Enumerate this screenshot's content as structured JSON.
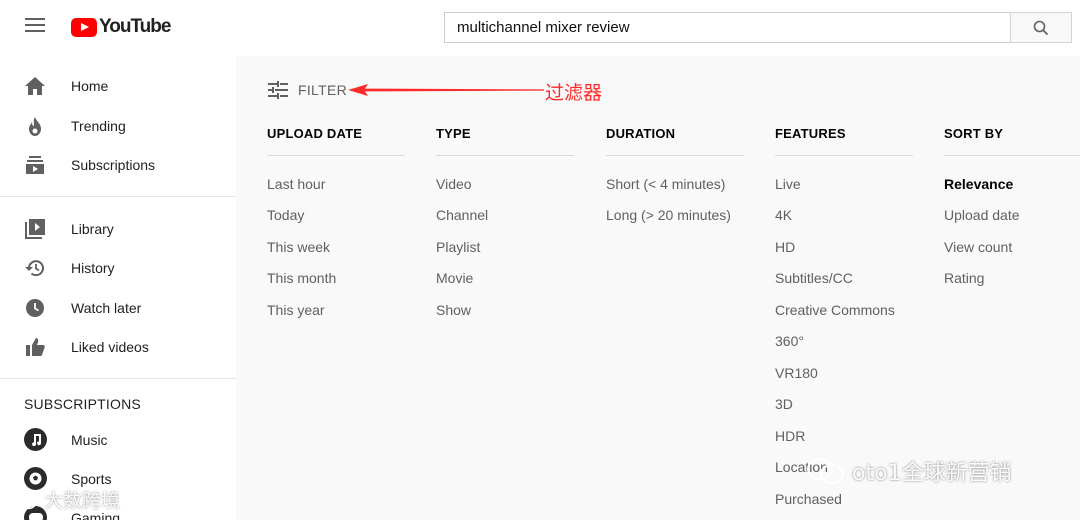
{
  "header": {
    "logo_text": "YouTube",
    "search_value": "multichannel mixer review",
    "icons": [
      "menu-icon",
      "search-icon"
    ],
    "brand_color": "#ff0000"
  },
  "sidebar": {
    "main_items": [
      {
        "label": "Home",
        "icon": "home-icon"
      },
      {
        "label": "Trending",
        "icon": "flame-icon"
      },
      {
        "label": "Subscriptions",
        "icon": "subscriptions-icon"
      }
    ],
    "library_items": [
      {
        "label": "Library",
        "icon": "library-icon"
      },
      {
        "label": "History",
        "icon": "history-icon"
      },
      {
        "label": "Watch later",
        "icon": "clock-icon"
      },
      {
        "label": "Liked videos",
        "icon": "thumbs-up-icon"
      }
    ],
    "subscriptions_title": "SUBSCRIPTIONS",
    "subscriptions": [
      {
        "label": "Music",
        "icon": "music-icon"
      },
      {
        "label": "Sports",
        "icon": "sports-icon"
      },
      {
        "label": "Gaming",
        "icon": "gaming-icon"
      }
    ]
  },
  "filter": {
    "label": "FILTER",
    "annotation": "过滤器",
    "annotation_color": "#ff2a2a",
    "columns": [
      {
        "title": "UPLOAD DATE",
        "options": [
          "Last hour",
          "Today",
          "This week",
          "This month",
          "This year"
        ]
      },
      {
        "title": "TYPE",
        "options": [
          "Video",
          "Channel",
          "Playlist",
          "Movie",
          "Show"
        ]
      },
      {
        "title": "DURATION",
        "options": [
          "Short (< 4 minutes)",
          "Long (> 20 minutes)"
        ]
      },
      {
        "title": "FEATURES",
        "options": [
          "Live",
          "4K",
          "HD",
          "Subtitles/CC",
          "Creative Commons",
          "360°",
          "VR180",
          "3D",
          "HDR",
          "Location",
          "Purchased"
        ]
      },
      {
        "title": "SORT BY",
        "options": [
          "Relevance",
          "Upload date",
          "View count",
          "Rating"
        ],
        "selected": "Relevance"
      }
    ]
  },
  "watermarks": {
    "left": "大数跨境",
    "right": "oto1全球新营销"
  }
}
